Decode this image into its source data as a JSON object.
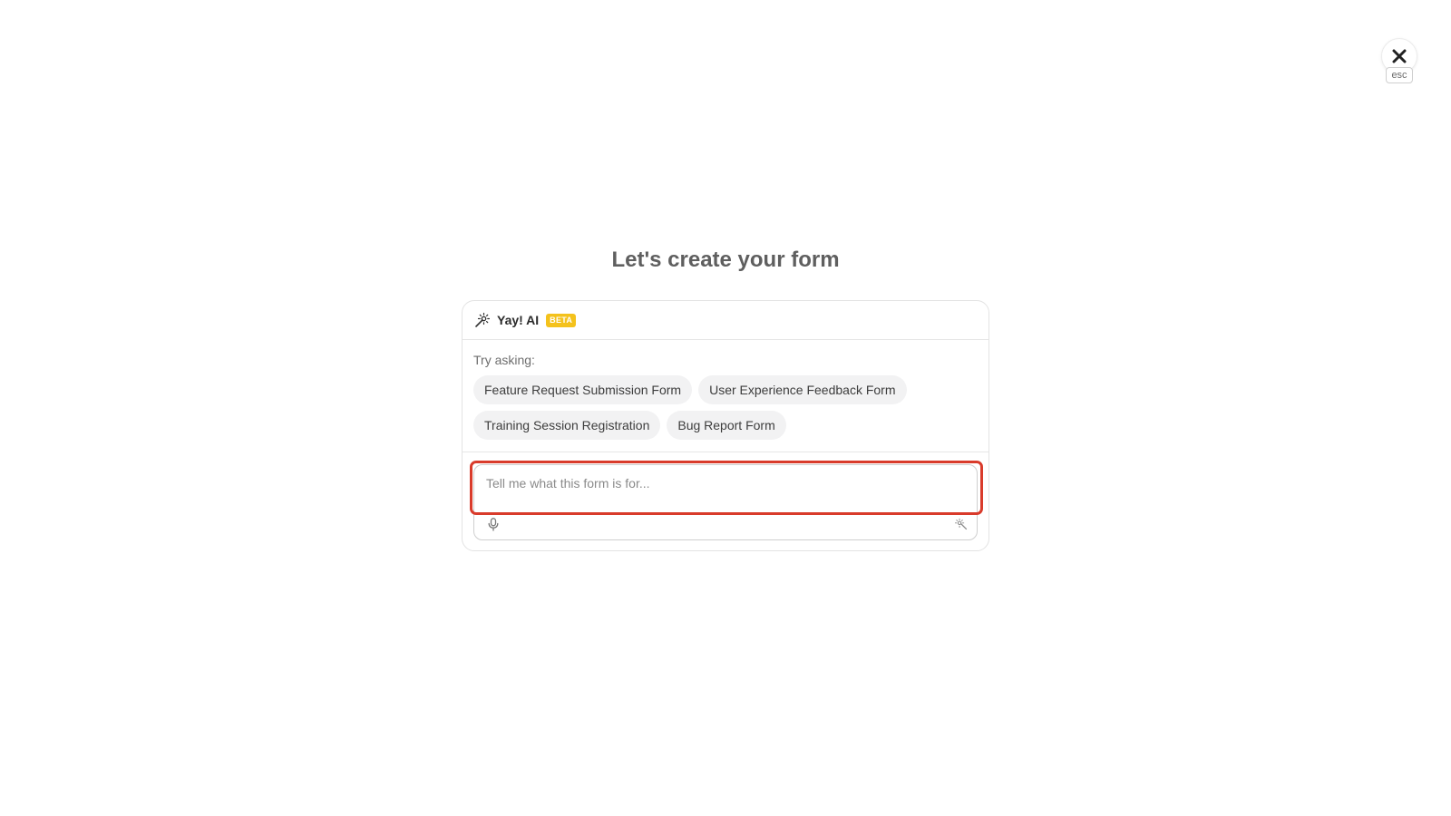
{
  "title": "Let's create your form",
  "close": {
    "icon": "close-icon",
    "esc_label": "esc"
  },
  "assistant": {
    "icon": "magic-wand-icon",
    "name": "Yay! AI",
    "badge": "BETA",
    "badge_color": "#f4c21c"
  },
  "suggestions": {
    "label": "Try asking:",
    "rows": [
      [
        "Feature Request Submission Form",
        "User Experience Feedback Form"
      ],
      [
        "Training Session Registration",
        "Bug Report Form"
      ]
    ]
  },
  "prompt": {
    "placeholder": "Tell me what this form is for...",
    "value": "",
    "mic_icon": "microphone-icon",
    "send_icon": "magic-wand-icon"
  },
  "highlight_color": "#d93b2b"
}
